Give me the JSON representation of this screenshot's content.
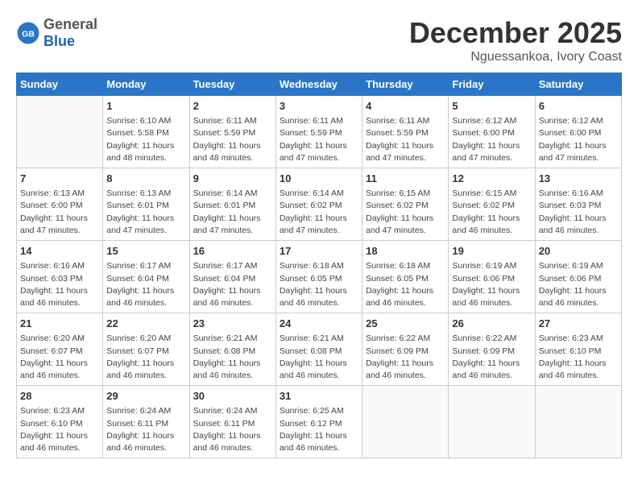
{
  "header": {
    "logo_general": "General",
    "logo_blue": "Blue",
    "month_title": "December 2025",
    "location": "Nguessankoa, Ivory Coast"
  },
  "days_of_week": [
    "Sunday",
    "Monday",
    "Tuesday",
    "Wednesday",
    "Thursday",
    "Friday",
    "Saturday"
  ],
  "weeks": [
    [
      {
        "day": "",
        "info": ""
      },
      {
        "day": "1",
        "info": "Sunrise: 6:10 AM\nSunset: 5:58 PM\nDaylight: 11 hours\nand 48 minutes."
      },
      {
        "day": "2",
        "info": "Sunrise: 6:11 AM\nSunset: 5:59 PM\nDaylight: 11 hours\nand 48 minutes."
      },
      {
        "day": "3",
        "info": "Sunrise: 6:11 AM\nSunset: 5:59 PM\nDaylight: 11 hours\nand 47 minutes."
      },
      {
        "day": "4",
        "info": "Sunrise: 6:11 AM\nSunset: 5:59 PM\nDaylight: 11 hours\nand 47 minutes."
      },
      {
        "day": "5",
        "info": "Sunrise: 6:12 AM\nSunset: 6:00 PM\nDaylight: 11 hours\nand 47 minutes."
      },
      {
        "day": "6",
        "info": "Sunrise: 6:12 AM\nSunset: 6:00 PM\nDaylight: 11 hours\nand 47 minutes."
      }
    ],
    [
      {
        "day": "7",
        "info": "Sunrise: 6:13 AM\nSunset: 6:00 PM\nDaylight: 11 hours\nand 47 minutes."
      },
      {
        "day": "8",
        "info": "Sunrise: 6:13 AM\nSunset: 6:01 PM\nDaylight: 11 hours\nand 47 minutes."
      },
      {
        "day": "9",
        "info": "Sunrise: 6:14 AM\nSunset: 6:01 PM\nDaylight: 11 hours\nand 47 minutes."
      },
      {
        "day": "10",
        "info": "Sunrise: 6:14 AM\nSunset: 6:02 PM\nDaylight: 11 hours\nand 47 minutes."
      },
      {
        "day": "11",
        "info": "Sunrise: 6:15 AM\nSunset: 6:02 PM\nDaylight: 11 hours\nand 47 minutes."
      },
      {
        "day": "12",
        "info": "Sunrise: 6:15 AM\nSunset: 6:02 PM\nDaylight: 11 hours\nand 46 minutes."
      },
      {
        "day": "13",
        "info": "Sunrise: 6:16 AM\nSunset: 6:03 PM\nDaylight: 11 hours\nand 46 minutes."
      }
    ],
    [
      {
        "day": "14",
        "info": "Sunrise: 6:16 AM\nSunset: 6:03 PM\nDaylight: 11 hours\nand 46 minutes."
      },
      {
        "day": "15",
        "info": "Sunrise: 6:17 AM\nSunset: 6:04 PM\nDaylight: 11 hours\nand 46 minutes."
      },
      {
        "day": "16",
        "info": "Sunrise: 6:17 AM\nSunset: 6:04 PM\nDaylight: 11 hours\nand 46 minutes."
      },
      {
        "day": "17",
        "info": "Sunrise: 6:18 AM\nSunset: 6:05 PM\nDaylight: 11 hours\nand 46 minutes."
      },
      {
        "day": "18",
        "info": "Sunrise: 6:18 AM\nSunset: 6:05 PM\nDaylight: 11 hours\nand 46 minutes."
      },
      {
        "day": "19",
        "info": "Sunrise: 6:19 AM\nSunset: 6:06 PM\nDaylight: 11 hours\nand 46 minutes."
      },
      {
        "day": "20",
        "info": "Sunrise: 6:19 AM\nSunset: 6:06 PM\nDaylight: 11 hours\nand 46 minutes."
      }
    ],
    [
      {
        "day": "21",
        "info": "Sunrise: 6:20 AM\nSunset: 6:07 PM\nDaylight: 11 hours\nand 46 minutes."
      },
      {
        "day": "22",
        "info": "Sunrise: 6:20 AM\nSunset: 6:07 PM\nDaylight: 11 hours\nand 46 minutes."
      },
      {
        "day": "23",
        "info": "Sunrise: 6:21 AM\nSunset: 6:08 PM\nDaylight: 11 hours\nand 46 minutes."
      },
      {
        "day": "24",
        "info": "Sunrise: 6:21 AM\nSunset: 6:08 PM\nDaylight: 11 hours\nand 46 minutes."
      },
      {
        "day": "25",
        "info": "Sunrise: 6:22 AM\nSunset: 6:09 PM\nDaylight: 11 hours\nand 46 minutes."
      },
      {
        "day": "26",
        "info": "Sunrise: 6:22 AM\nSunset: 6:09 PM\nDaylight: 11 hours\nand 46 minutes."
      },
      {
        "day": "27",
        "info": "Sunrise: 6:23 AM\nSunset: 6:10 PM\nDaylight: 11 hours\nand 46 minutes."
      }
    ],
    [
      {
        "day": "28",
        "info": "Sunrise: 6:23 AM\nSunset: 6:10 PM\nDaylight: 11 hours\nand 46 minutes."
      },
      {
        "day": "29",
        "info": "Sunrise: 6:24 AM\nSunset: 6:11 PM\nDaylight: 11 hours\nand 46 minutes."
      },
      {
        "day": "30",
        "info": "Sunrise: 6:24 AM\nSunset: 6:11 PM\nDaylight: 11 hours\nand 46 minutes."
      },
      {
        "day": "31",
        "info": "Sunrise: 6:25 AM\nSunset: 6:12 PM\nDaylight: 11 hours\nand 46 minutes."
      },
      {
        "day": "",
        "info": ""
      },
      {
        "day": "",
        "info": ""
      },
      {
        "day": "",
        "info": ""
      }
    ]
  ]
}
